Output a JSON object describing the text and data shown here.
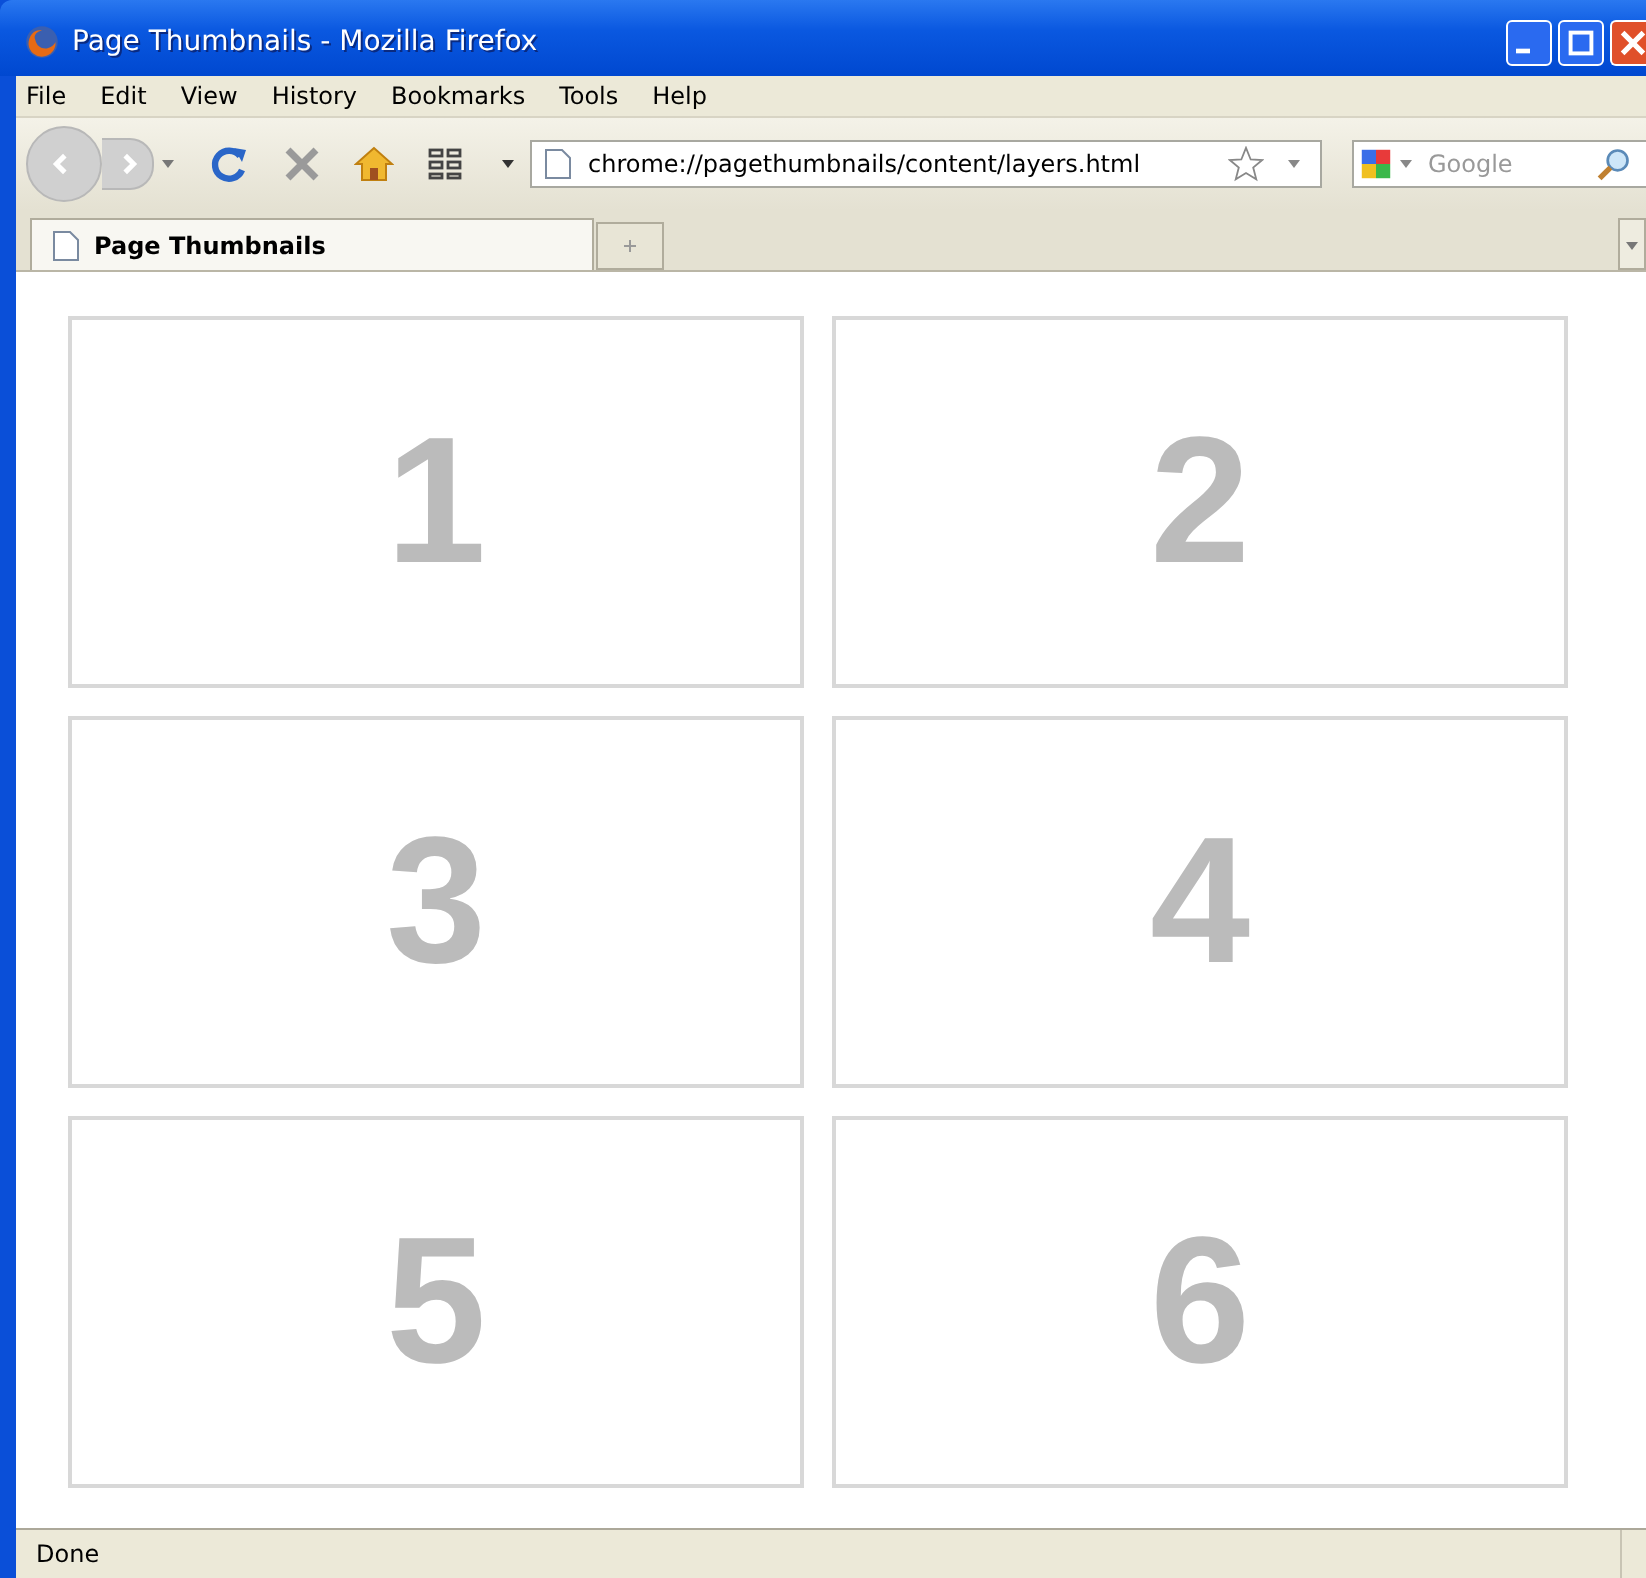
{
  "window": {
    "title": "Page Thumbnails - Mozilla Firefox"
  },
  "menu": [
    "File",
    "Edit",
    "View",
    "History",
    "Bookmarks",
    "Tools",
    "Help"
  ],
  "toolbar": {
    "url": "chrome://pagethumbnails/content/layers.html",
    "search": {
      "placeholder": "Google"
    }
  },
  "tabs": [
    {
      "label": "Page Thumbnails",
      "selected": true
    }
  ],
  "thumbnails": [
    "1",
    "2",
    "3",
    "4",
    "5",
    "6"
  ],
  "status_bar": "Done"
}
